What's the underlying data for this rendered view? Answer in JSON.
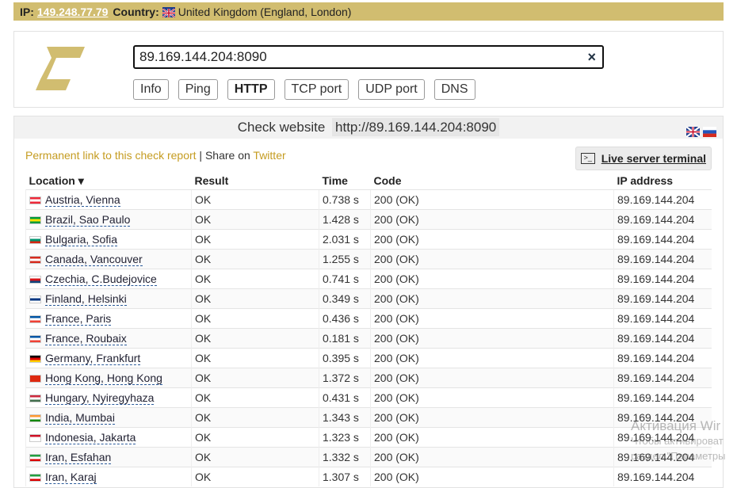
{
  "topbar": {
    "ip_label": "IP:",
    "ip_value": "149.248.77.79",
    "country_label": "Country:",
    "country_value": "United Kingdom (England, London)"
  },
  "search": {
    "value": "89.169.144.204:8090",
    "clear_icon": "×"
  },
  "tabs": [
    {
      "label": "Info"
    },
    {
      "label": "Ping"
    },
    {
      "label": "HTTP"
    },
    {
      "label": "TCP port"
    },
    {
      "label": "UDP port"
    },
    {
      "label": "DNS"
    }
  ],
  "panel": {
    "title_prefix": "Check website",
    "title_url": "http://89.169.144.204:8090",
    "permalink": "Permanent link to this check report",
    "share_text": " | Share on ",
    "twitter": "Twitter",
    "terminal": "Live server terminal",
    "terminal_icon": ">_"
  },
  "table": {
    "headers": {
      "location": "Location ▾",
      "result": "Result",
      "time": "Time",
      "code": "Code",
      "ip": "IP address"
    },
    "rows": [
      {
        "loc": "Austria, Vienna",
        "flag": [
          "#ed2939",
          "#ffffff",
          "#ed2939"
        ],
        "result": "OK",
        "time": "0.738 s",
        "code": "200 (OK)",
        "ip": "89.169.144.204"
      },
      {
        "loc": "Brazil, Sao Paulo",
        "flag": [
          "#009b3a",
          "#fedf00",
          "#009b3a"
        ],
        "result": "OK",
        "time": "1.428 s",
        "code": "200 (OK)",
        "ip": "89.169.144.204"
      },
      {
        "loc": "Bulgaria, Sofia",
        "flag": [
          "#ffffff",
          "#00966e",
          "#d62612"
        ],
        "result": "OK",
        "time": "2.031 s",
        "code": "200 (OK)",
        "ip": "89.169.144.204"
      },
      {
        "loc": "Canada, Vancouver",
        "flag": [
          "#d52b1e",
          "#ffffff",
          "#d52b1e"
        ],
        "result": "OK",
        "time": "1.255 s",
        "code": "200 (OK)",
        "ip": "89.169.144.204"
      },
      {
        "loc": "Czechia, C.Budejovice",
        "flag": [
          "#ffffff",
          "#d7141a",
          "#11457e"
        ],
        "result": "OK",
        "time": "0.741 s",
        "code": "200 (OK)",
        "ip": "89.169.144.204"
      },
      {
        "loc": "Finland, Helsinki",
        "flag": [
          "#ffffff",
          "#003580",
          "#ffffff"
        ],
        "result": "OK",
        "time": "0.349 s",
        "code": "200 (OK)",
        "ip": "89.169.144.204"
      },
      {
        "loc": "France, Paris",
        "flag": [
          "#0055a4",
          "#ffffff",
          "#ef4135"
        ],
        "result": "OK",
        "time": "0.436 s",
        "code": "200 (OK)",
        "ip": "89.169.144.204"
      },
      {
        "loc": "France, Roubaix",
        "flag": [
          "#0055a4",
          "#ffffff",
          "#ef4135"
        ],
        "result": "OK",
        "time": "0.181 s",
        "code": "200 (OK)",
        "ip": "89.169.144.204"
      },
      {
        "loc": "Germany, Frankfurt",
        "flag": [
          "#000000",
          "#dd0000",
          "#ffce00"
        ],
        "result": "OK",
        "time": "0.395 s",
        "code": "200 (OK)",
        "ip": "89.169.144.204"
      },
      {
        "loc": "Hong Kong, Hong Kong",
        "flag": [
          "#de2910",
          "#de2910",
          "#de2910"
        ],
        "result": "OK",
        "time": "1.372 s",
        "code": "200 (OK)",
        "ip": "89.169.144.204"
      },
      {
        "loc": "Hungary, Nyiregyhaza",
        "flag": [
          "#cd2a3e",
          "#ffffff",
          "#436f4d"
        ],
        "result": "OK",
        "time": "0.431 s",
        "code": "200 (OK)",
        "ip": "89.169.144.204"
      },
      {
        "loc": "India, Mumbai",
        "flag": [
          "#ff9933",
          "#ffffff",
          "#138808"
        ],
        "result": "OK",
        "time": "1.343 s",
        "code": "200 (OK)",
        "ip": "89.169.144.204"
      },
      {
        "loc": "Indonesia, Jakarta",
        "flag": [
          "#ce1126",
          "#ffffff",
          "#ffffff"
        ],
        "result": "OK",
        "time": "1.323 s",
        "code": "200 (OK)",
        "ip": "89.169.144.204"
      },
      {
        "loc": "Iran, Esfahan",
        "flag": [
          "#239f40",
          "#ffffff",
          "#da0000"
        ],
        "result": "OK",
        "time": "1.332 s",
        "code": "200 (OK)",
        "ip": "89.169.144.204"
      },
      {
        "loc": "Iran, Karaj",
        "flag": [
          "#239f40",
          "#ffffff",
          "#da0000"
        ],
        "result": "OK",
        "time": "1.307 s",
        "code": "200 (OK)",
        "ip": "89.169.144.204"
      }
    ]
  },
  "watermark": {
    "line1": "Активация Wir",
    "line2": "Чтобы активироват",
    "line3": "раздел \"Параметры"
  },
  "colors": {
    "accent": "#d1bd70",
    "link": "#c59c21"
  }
}
